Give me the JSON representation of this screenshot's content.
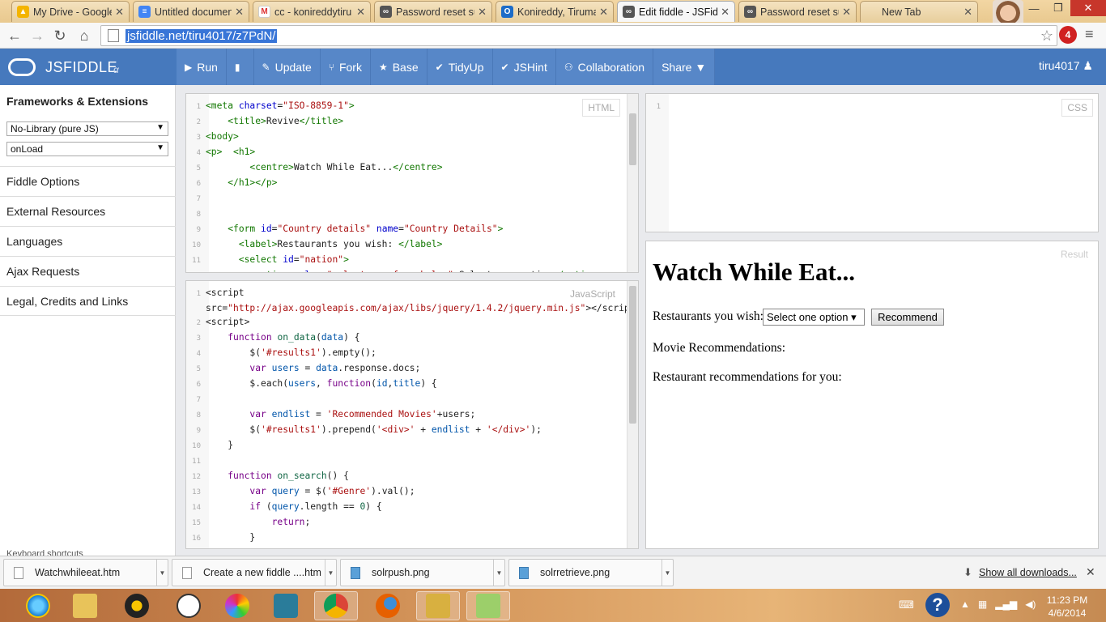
{
  "browser": {
    "tabs": [
      {
        "title": "My Drive - Google",
        "icon": "google-drive-icon"
      },
      {
        "title": "Untitled document",
        "icon": "google-docs-icon"
      },
      {
        "title": "cc - konireddytiru",
        "icon": "gmail-icon"
      },
      {
        "title": "Password reset suc",
        "icon": "jsfiddle-icon"
      },
      {
        "title": "Konireddy, Tiruma",
        "icon": "outlook-icon"
      },
      {
        "title": "Edit fiddle - JSFidd",
        "icon": "jsfiddle-icon"
      },
      {
        "title": "Password reset suc",
        "icon": "jsfiddle-icon"
      },
      {
        "title": "New Tab",
        "icon": "blank-tab-icon"
      }
    ],
    "url": "jsfiddle.net/tiru4017/z7PdN/",
    "extension_badge": "4"
  },
  "jsfiddle": {
    "brand": "JSFIDDLE",
    "alpha": "α",
    "actions": [
      {
        "label": "Run",
        "icon": "▶"
      },
      {
        "label": "",
        "icon": "▮"
      },
      {
        "label": "Update",
        "icon": "✎"
      },
      {
        "label": "Fork",
        "icon": "⑂"
      },
      {
        "label": "Base",
        "icon": "★"
      },
      {
        "label": "TidyUp",
        "icon": "✔"
      },
      {
        "label": "JSHint",
        "icon": "✔"
      },
      {
        "label": "Collaboration",
        "icon": "⚇"
      },
      {
        "label": "Share ▼",
        "icon": ""
      }
    ],
    "user": "tiru4017 ♟"
  },
  "sidebar": {
    "title": "Frameworks & Extensions",
    "library": "No-Library (pure JS)",
    "load": "onLoad",
    "items": [
      "Fiddle Options",
      "External Resources",
      "Languages",
      "Ajax Requests",
      "Legal, Credits and Links"
    ],
    "footer": "Keyboard shortcuts"
  },
  "panels": {
    "html_label": "HTML",
    "css_label": "CSS",
    "js_label": "JavaScript",
    "result_label": "Result",
    "css_line": "1"
  },
  "result": {
    "heading": "Watch While Eat...",
    "label": "Restaurants you wish:",
    "select_value": "Select one option ▾",
    "button": "Recommend",
    "movie_text": "Movie Recommendations:",
    "restaurant_text": "Restaurant recommendations for you:"
  },
  "downloads": {
    "items": [
      "Watchwhileeat.htm",
      "Create a new fiddle ....htm",
      "solrpush.png",
      "solrretrieve.png"
    ],
    "show_all": "Show all downloads..."
  },
  "taskbar": {
    "time": "11:23 PM",
    "date": "4/6/2014"
  }
}
